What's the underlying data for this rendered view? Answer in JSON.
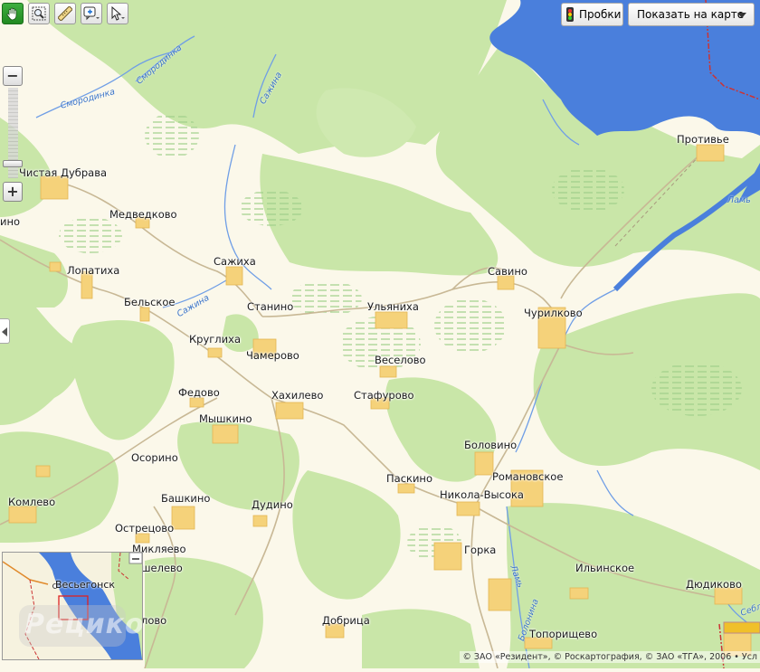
{
  "toolbar": {
    "tools": [
      {
        "icon": "hand-icon",
        "active": true
      },
      {
        "icon": "zoom-area-icon",
        "active": false
      },
      {
        "icon": "ruler-icon",
        "active": false
      },
      {
        "icon": "add-placemark-icon",
        "active": false
      },
      {
        "icon": "select-cursor-icon",
        "active": false
      }
    ]
  },
  "zoom": {
    "plus": "+",
    "minus": "−"
  },
  "traffic_label": "Пробки",
  "show_on_map_label": "Показать на карте",
  "places": [
    "Чистая Дубрава",
    "Медведково",
    "Лопатиха",
    "Бельское",
    "Сажиха",
    "Станино",
    "Ульяниха",
    "Савино",
    "Чурилково",
    "Противье",
    "Круглиха",
    "Чамерово",
    "Веселово",
    "Федово",
    "Хахилево",
    "Стафурово",
    "Мышкино",
    "Боловино",
    "Осорино",
    "Романовское",
    "Паскино",
    "Никола-Высока",
    "Комлево",
    "Башкино",
    "Дудино",
    "Острецово",
    "Микляево",
    "Горка",
    "Ильинское",
    "Дюдиково",
    "Добрица",
    "Топорищево",
    "ино",
    "шелево",
    "лово"
  ],
  "rivers": [
    "Смородинка",
    "Смородинка",
    "Сажина",
    "Сажина",
    "Ламь",
    "Ламь",
    "Болонина",
    "Себла"
  ],
  "minimap": {
    "city": "Весьегонск",
    "watermark": "Рецикозя"
  },
  "copyright": "© ЗАО «Резидент», © Роскартография, © ЗАО «ТГА», 2006 • Усл",
  "colors": {
    "forest": "#c9e6a8",
    "field": "#fbf8ea",
    "water": "#4a7fdc",
    "road": "#c8b895",
    "settlement": "#f5d27a",
    "active_tool": "#2d9a2d"
  }
}
